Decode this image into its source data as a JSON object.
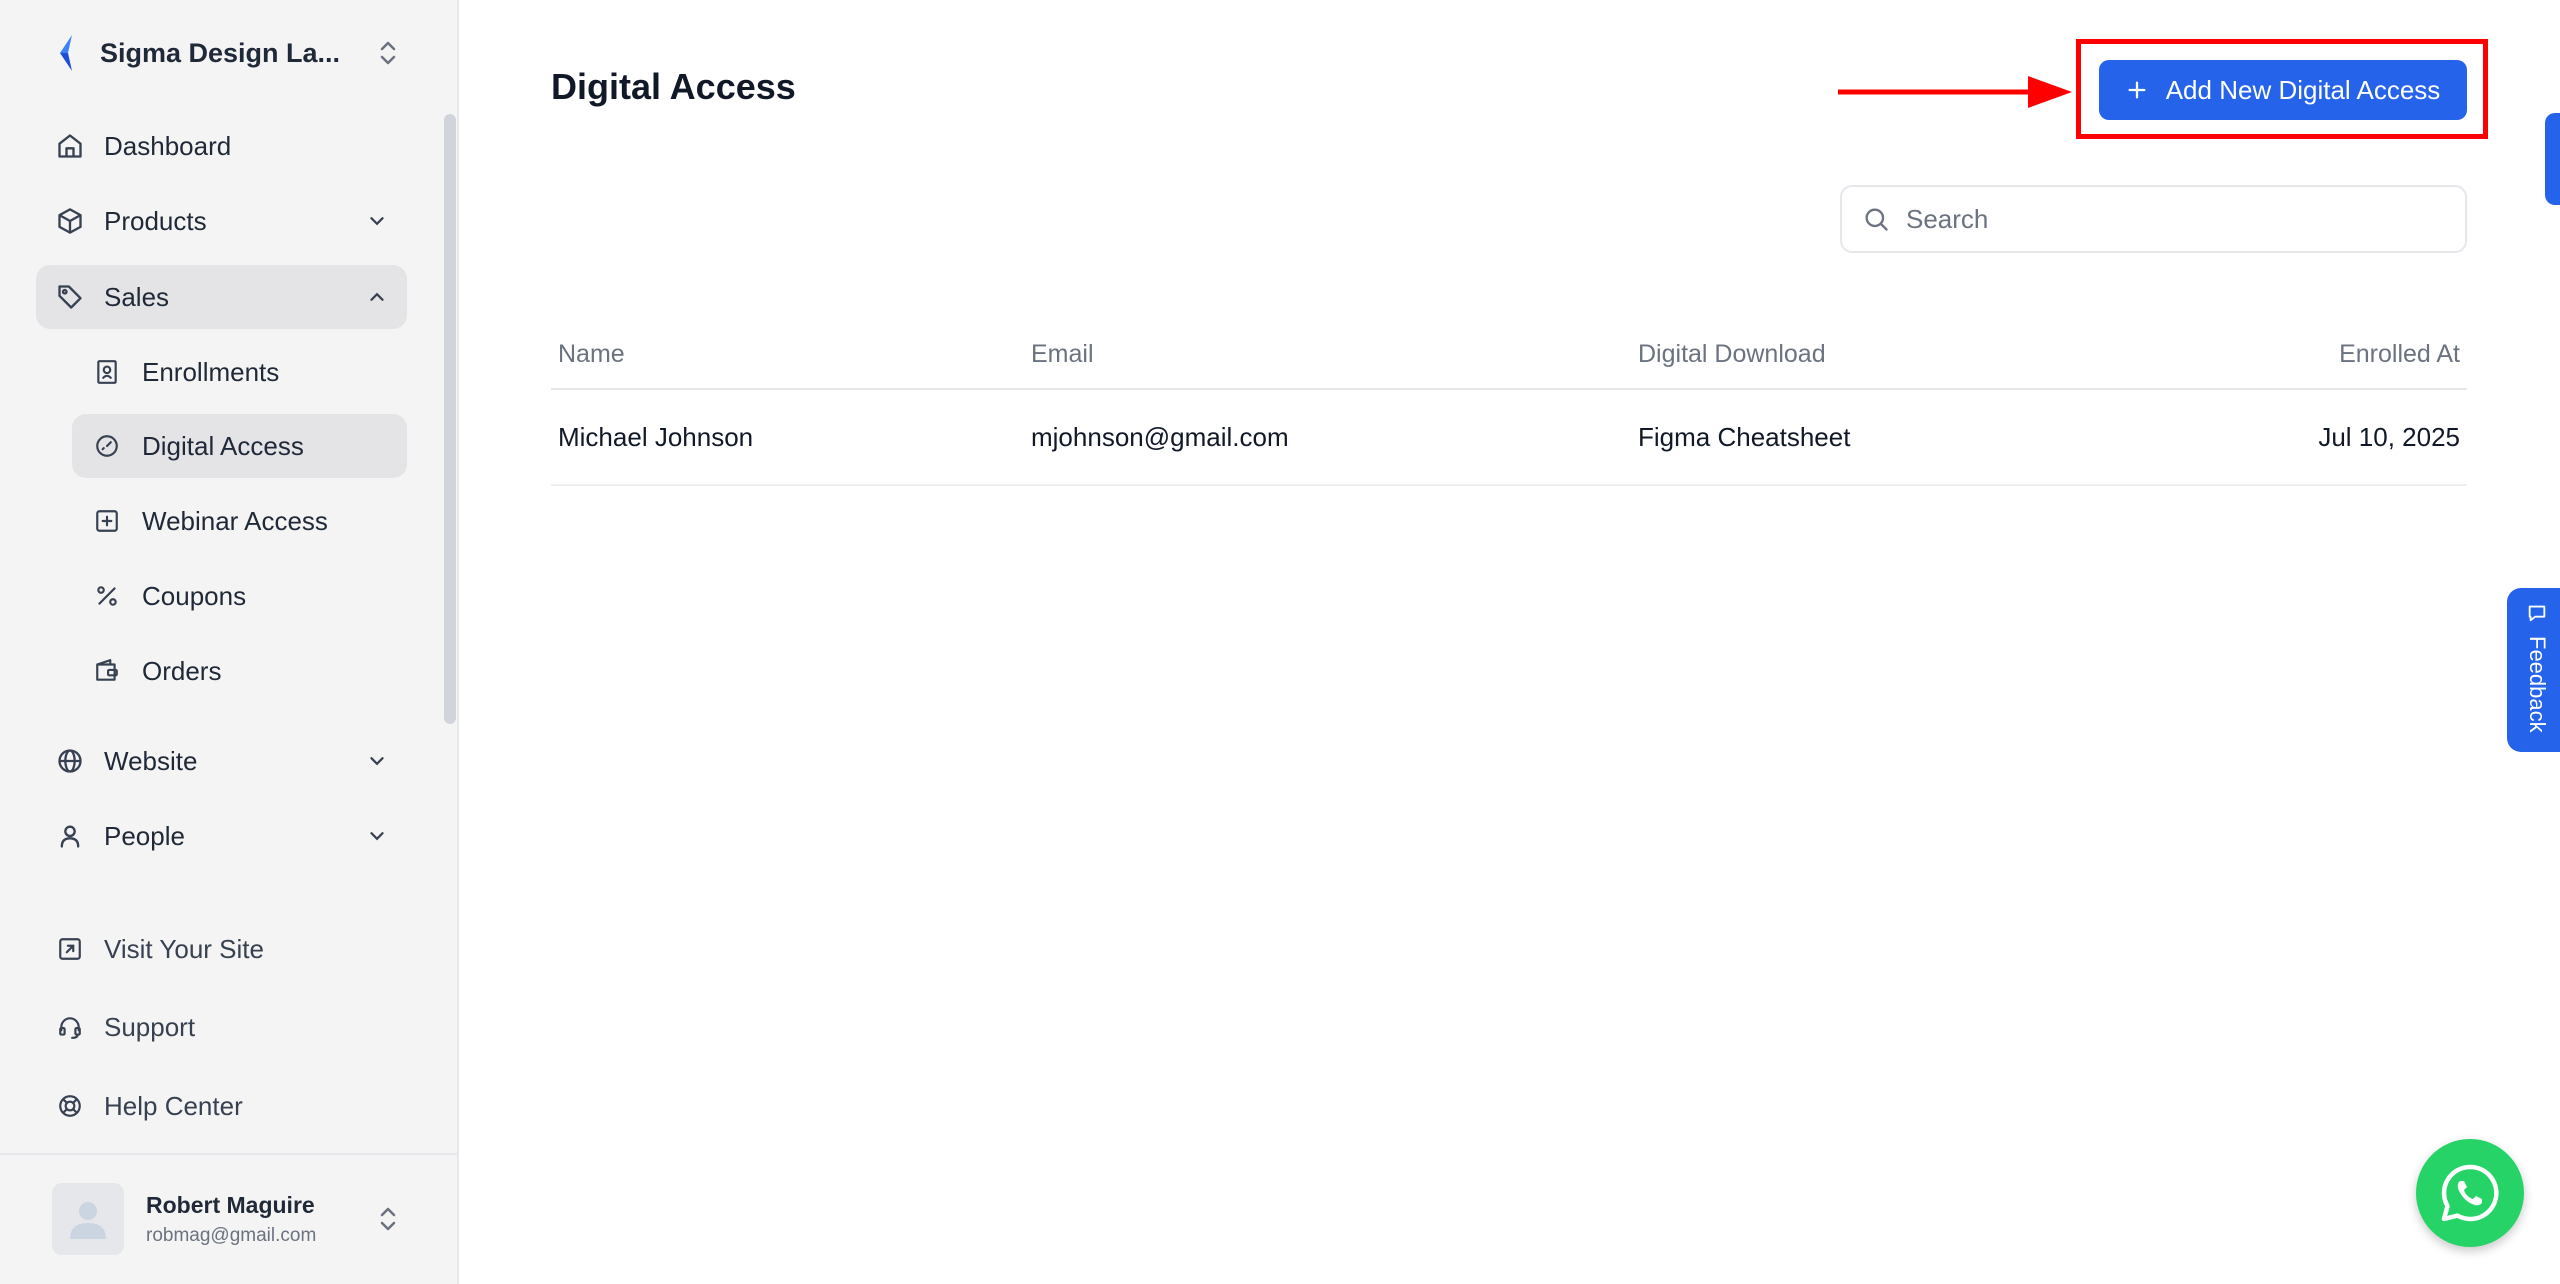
{
  "workspace": {
    "name": "Sigma Design La..."
  },
  "sidebar": {
    "items": [
      {
        "label": "Dashboard",
        "icon": "home-icon"
      },
      {
        "label": "Products",
        "icon": "box-icon"
      },
      {
        "label": "Sales",
        "icon": "tag-icon",
        "expanded": true
      },
      {
        "label": "Enrollments",
        "icon": "contact-card-icon"
      },
      {
        "label": "Digital Access",
        "icon": "gauge-icon",
        "active": true
      },
      {
        "label": "Webinar Access",
        "icon": "plus-square-icon"
      },
      {
        "label": "Coupons",
        "icon": "percent-icon"
      },
      {
        "label": "Orders",
        "icon": "wallet-icon"
      },
      {
        "label": "Website",
        "icon": "globe-icon"
      },
      {
        "label": "People",
        "icon": "user-icon"
      }
    ],
    "bottom": [
      {
        "label": "Visit Your Site",
        "icon": "external-link-icon"
      },
      {
        "label": "Support",
        "icon": "headset-icon"
      },
      {
        "label": "Help Center",
        "icon": "lifebuoy-icon"
      }
    ],
    "user": {
      "name": "Robert Maguire",
      "email": "robmag@gmail.com"
    }
  },
  "main": {
    "title": "Digital Access",
    "add_button": "Add New Digital Access",
    "search_placeholder": "Search",
    "table": {
      "headers": [
        "Name",
        "Email",
        "Digital Download",
        "Enrolled At"
      ],
      "rows": [
        [
          "Michael Johnson",
          "mjohnson@gmail.com",
          "Figma Cheatsheet",
          "Jul 10, 2025"
        ]
      ]
    }
  },
  "feedback": {
    "label": "Feedback"
  },
  "colors": {
    "accent": "#2563eb",
    "highlight": "#ff0000",
    "whatsapp": "#25d366"
  }
}
